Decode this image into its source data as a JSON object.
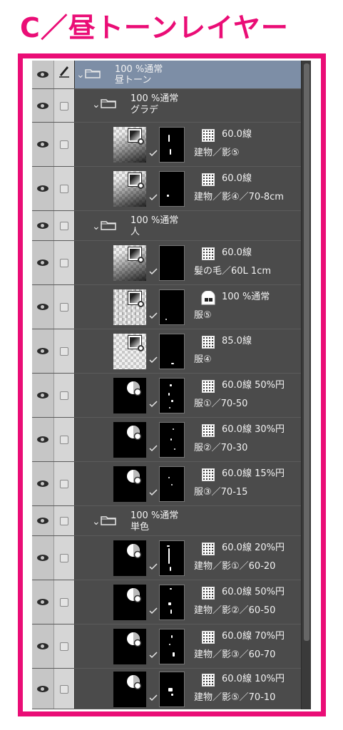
{
  "title": "C／昼トーンレイヤー",
  "root_folder": {
    "mode": "100 %通常",
    "name": "昼トーン"
  },
  "folders": [
    {
      "mode": "100 %通常",
      "name": "グラデ"
    },
    {
      "mode": "100 %通常",
      "name": "人"
    },
    {
      "mode": "100 %通常",
      "name": "単色"
    }
  ],
  "layers": [
    {
      "mode": "60.0線",
      "name": "建物／影⑤"
    },
    {
      "mode": "60.0線",
      "name": "建物／影④／70-8cm"
    },
    {
      "mode": "60.0線",
      "name": "髪の毛／60L 1cm"
    },
    {
      "mode": "100 %通常",
      "name": "服⑤"
    },
    {
      "mode": "85.0線",
      "name": "服④"
    },
    {
      "mode": "60.0線 50%円",
      "name": "服①／70-50"
    },
    {
      "mode": "60.0線 30%円",
      "name": "服②／70-30"
    },
    {
      "mode": "60.0線 15%円",
      "name": "服③／70-15"
    },
    {
      "mode": "60.0線 20%円",
      "name": "建物／影①／60-20"
    },
    {
      "mode": "60.0線 50%円",
      "name": "建物／影②／60-50"
    },
    {
      "mode": "60.0線 70%円",
      "name": "建物／影③／60-70"
    },
    {
      "mode": "60.0線 10%円",
      "name": "建物／影⑤／70-10"
    }
  ],
  "icons": {
    "visibility": "eye-icon",
    "edit": "pencil-icon",
    "folder": "folder-icon",
    "expand": "chevron-down-icon",
    "tone": "halftone-icon",
    "fill": "fill-layer-icon",
    "mask_link": "checkmark-icon"
  },
  "colors": {
    "accent": "#ea0d76",
    "panel": "#4b4b4b",
    "selected": "#7d8ea6"
  }
}
